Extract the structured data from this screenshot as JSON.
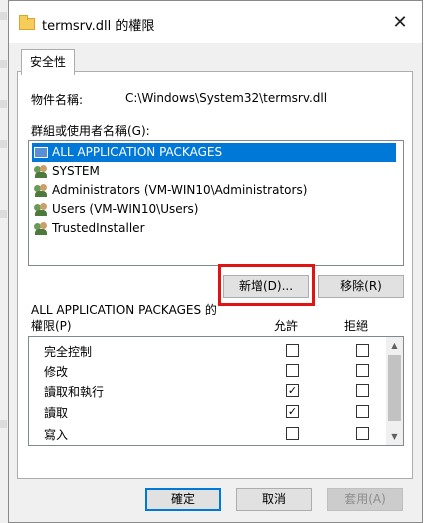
{
  "window": {
    "title": "termsrv.dll 的權限",
    "close_glyph": "✕"
  },
  "tab": {
    "label": "安全性"
  },
  "object": {
    "label": "物件名稱:",
    "value": "C:\\Windows\\System32\\termsrv.dll"
  },
  "groups": {
    "label": "群組或使用者名稱(G):",
    "items": [
      {
        "label": "ALL APPLICATION PACKAGES",
        "selected": true,
        "icon": "package-icon"
      },
      {
        "label": "SYSTEM",
        "icon": "users-icon"
      },
      {
        "label": "Administrators (VM-WIN10\\Administrators)",
        "icon": "users-icon"
      },
      {
        "label": "Users (VM-WIN10\\Users)",
        "icon": "users-icon"
      },
      {
        "label": "TrustedInstaller",
        "icon": "users-icon"
      }
    ]
  },
  "buttons": {
    "add": "新增(D)...",
    "remove": "移除(R)",
    "ok": "確定",
    "cancel": "取消",
    "apply": "套用(A)"
  },
  "permissions": {
    "label_line1": "ALL APPLICATION PACKAGES 的",
    "label_line2": "權限(P)",
    "allow_header": "允許",
    "deny_header": "拒絕",
    "rows": [
      {
        "name": "完全控制",
        "allow": false,
        "deny": false
      },
      {
        "name": "修改",
        "allow": false,
        "deny": false
      },
      {
        "name": "讀取和執行",
        "allow": true,
        "deny": false
      },
      {
        "name": "讀取",
        "allow": true,
        "deny": false
      },
      {
        "name": "寫入",
        "allow": false,
        "deny": false
      }
    ]
  },
  "colors": {
    "selection": "#0078d7",
    "highlight_box": "#e11414"
  }
}
